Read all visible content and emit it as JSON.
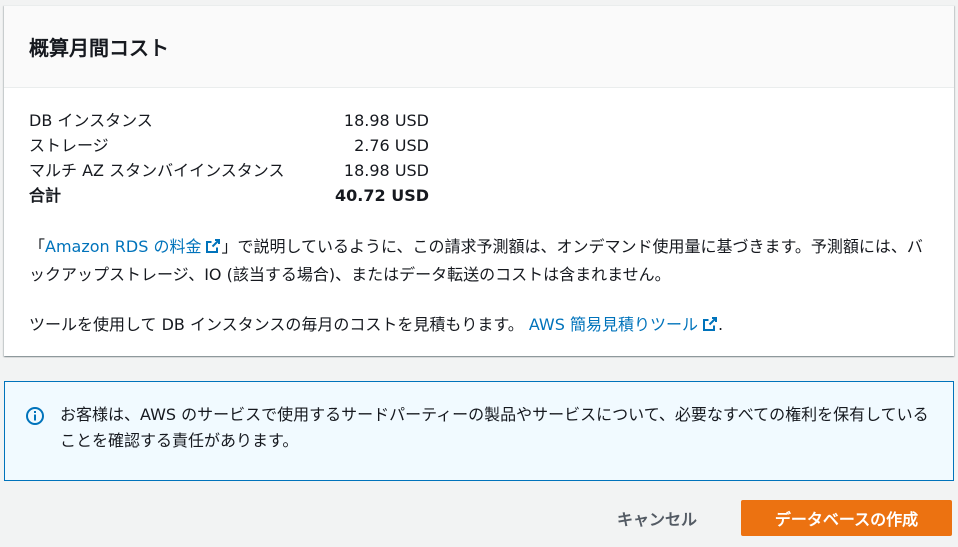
{
  "cost_card": {
    "title": "概算月間コスト",
    "rows": [
      {
        "label": "DB インスタンス",
        "amount": "18.98 USD"
      },
      {
        "label": "ストレージ",
        "amount": "2.76 USD"
      },
      {
        "label": "マルチ AZ スタンバイインスタンス",
        "amount": "18.98 USD"
      }
    ],
    "total": {
      "label": "合計",
      "amount": "40.72 USD"
    },
    "description": {
      "prefix": "「",
      "link": "Amazon RDS の料金",
      "suffix": "」で説明しているように、この請求予測額は、オンデマンド使用量に基づきます。予測額には、バックアップストレージ、IO (該当する場合)、またはデータ転送のコストは含まれません。"
    },
    "calculator": {
      "text": "ツールを使用して DB インスタンスの毎月のコストを見積もります。 ",
      "link": "AWS 簡易見積りツール",
      "suffix": "."
    }
  },
  "alert": {
    "icon": "info-icon",
    "text": "お客様は、AWS のサービスで使用するサードパーティーの製品やサービスについて、必要なすべての権利を保有していることを確認する責任があります。"
  },
  "footer": {
    "cancel_label": "キャンセル",
    "create_label": "データベースの作成"
  },
  "colors": {
    "link": "#0073bb",
    "primary_button": "#ec7211",
    "alert_border": "#0073bb",
    "alert_background": "#f1faff"
  }
}
